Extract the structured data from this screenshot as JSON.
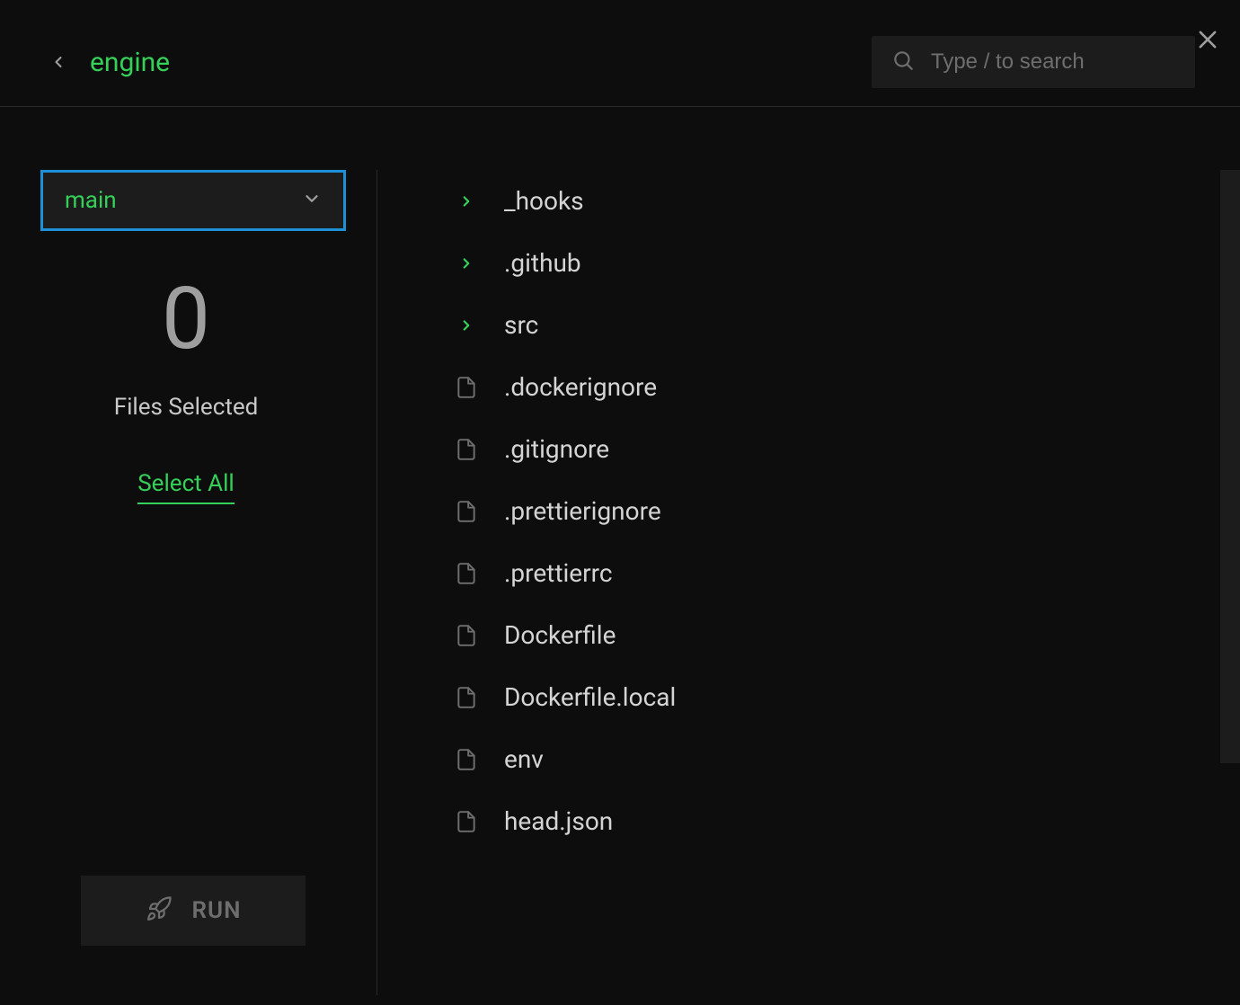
{
  "header": {
    "title": "engine"
  },
  "search": {
    "placeholder": "Type / to search"
  },
  "sidebar": {
    "branch": "main",
    "count": "0",
    "count_label": "Files Selected",
    "select_all": "Select All",
    "run_label": "RUN"
  },
  "tree": {
    "items": [
      {
        "type": "folder",
        "name": "_hooks"
      },
      {
        "type": "folder",
        "name": ".github"
      },
      {
        "type": "folder",
        "name": "src"
      },
      {
        "type": "file",
        "name": ".dockerignore"
      },
      {
        "type": "file",
        "name": ".gitignore"
      },
      {
        "type": "file",
        "name": ".prettierignore"
      },
      {
        "type": "file",
        "name": ".prettierrc"
      },
      {
        "type": "file",
        "name": "Dockerfile"
      },
      {
        "type": "file",
        "name": "Dockerfile.local"
      },
      {
        "type": "file",
        "name": "env"
      },
      {
        "type": "file",
        "name": "head.json"
      }
    ]
  }
}
